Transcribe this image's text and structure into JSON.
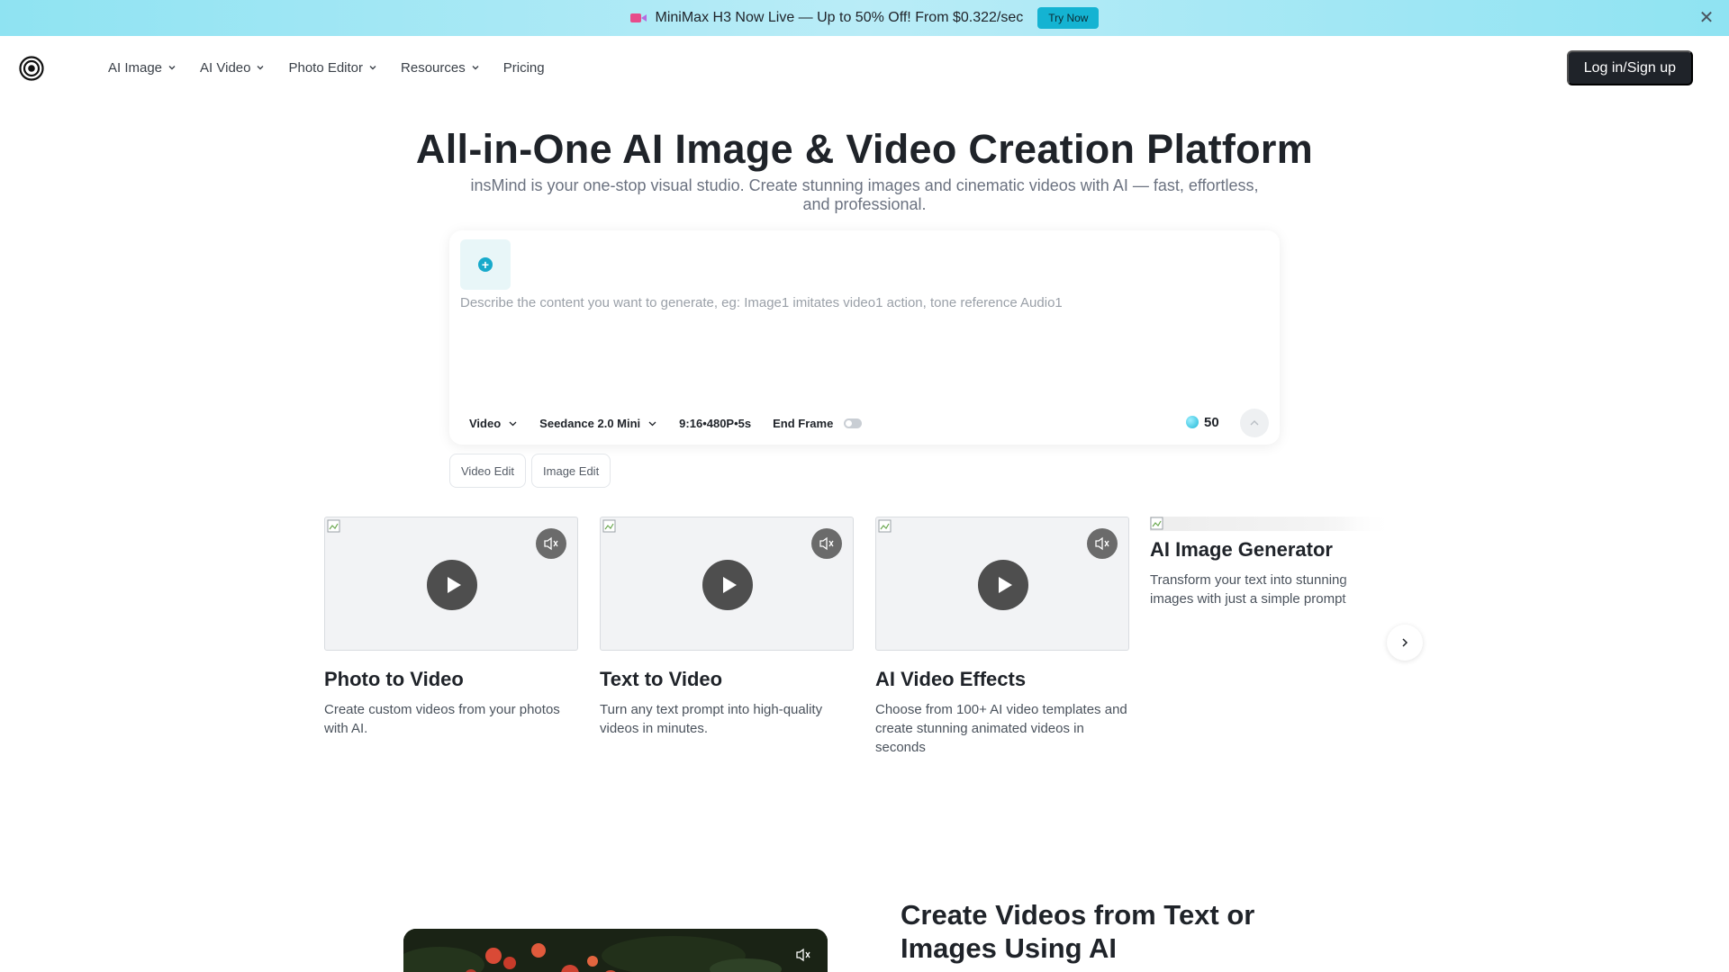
{
  "banner": {
    "text": "MiniMax H3 Now Live — Up to 50% Off! From $0.322/sec",
    "button_label": "Try Now",
    "close_glyph": "✕",
    "icon": "video-camera-icon"
  },
  "nav": {
    "logo_icon": "spiral-logo-icon",
    "items": [
      {
        "label": "AI Image",
        "has_dropdown": true
      },
      {
        "label": "AI Video",
        "has_dropdown": true
      },
      {
        "label": "Photo Editor",
        "has_dropdown": true
      },
      {
        "label": "Resources",
        "has_dropdown": true
      },
      {
        "label": "Pricing",
        "has_dropdown": false
      }
    ],
    "login_label": "Log in/Sign up"
  },
  "hero": {
    "title": "All-in-One AI Image & Video Creation Platform",
    "subtitle": "insMind is your one-stop visual studio. Create stunning images and cinematic videos with AI — fast, effortless, and professional."
  },
  "prompt": {
    "placeholder": "Describe the content you want to generate, eg: Image1 imitates video1 action, tone reference Audio1",
    "upload_icon": "plus-circle-icon",
    "mode": "Video",
    "model": "Seedance 2.0 Mini",
    "settings": "9:16•480P•5s",
    "end_frame_label": "End Frame",
    "end_frame_enabled": false,
    "credits": "50",
    "send_icon": "chevron-up-icon"
  },
  "chips": [
    "Video Edit",
    "Image Edit"
  ],
  "cards": [
    {
      "title": "Photo to Video",
      "desc": "Create custom videos from your photos with AI."
    },
    {
      "title": "Text to Video",
      "desc": "Turn any text prompt into high-quality videos in minutes."
    },
    {
      "title": "AI Video Effects",
      "desc": "Choose from 100+ AI video templates and create stunning animated videos in seconds"
    },
    {
      "title": "AI Image Generator",
      "desc": "Transform your text into stunning images with just a simple prompt"
    }
  ],
  "section": {
    "title": "Create Videos from Text or Images Using AI"
  },
  "colors": {
    "accent": "#14b3d2",
    "dark": "#1f2329",
    "banner_bg": "#8fe3f2"
  }
}
